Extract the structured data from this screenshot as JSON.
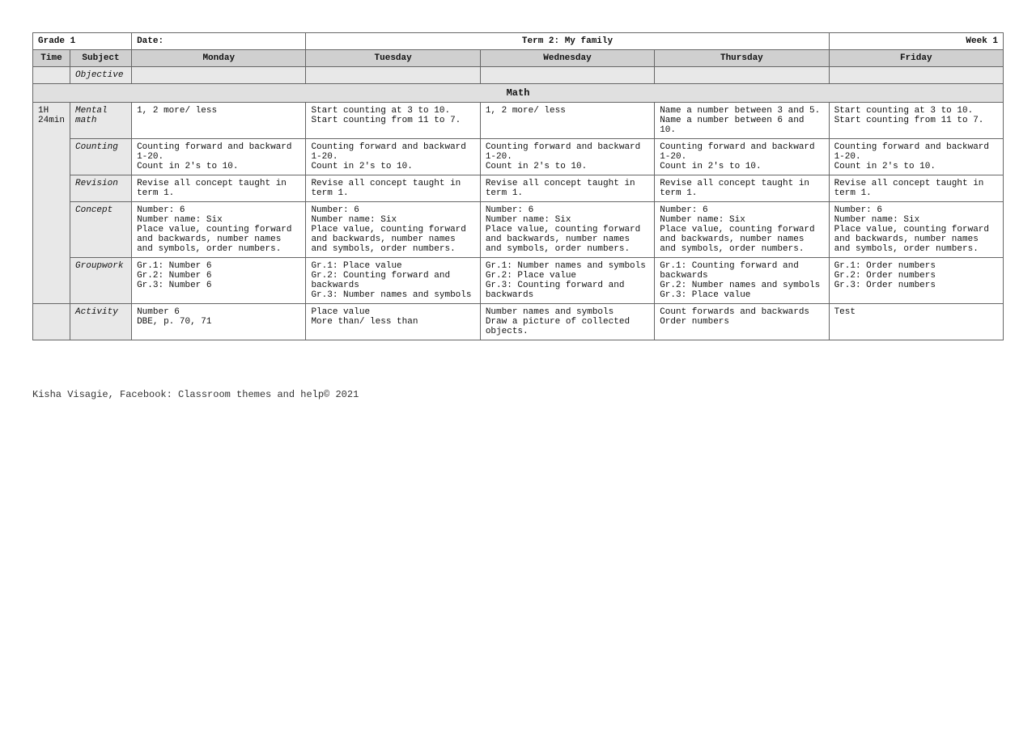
{
  "header": {
    "grade_label": "Grade 1",
    "date_label": "Date:",
    "term_label": "Term 2: My family",
    "week_label": "Week 1"
  },
  "columns": {
    "time": "Time",
    "subject": "Subject",
    "monday": "Monday",
    "tuesday": "Tuesday",
    "wednesday": "Wednesday",
    "thursday": "Thursday",
    "friday": "Friday",
    "objective": "Objective"
  },
  "math_section": "Math",
  "rows": {
    "time": "1H\n24min",
    "subject": "Mental math",
    "monday_mental": "1, 2 more/ less",
    "tuesday_mental": "Start counting at 3 to 10.\nStart counting from 11 to 7.",
    "wednesday_mental": "1, 2 more/ less",
    "thursday_mental": "Name a number between 3 and 5.\nName a number between 6 and 10.",
    "friday_mental": "Start counting at 3 to 10.\nStart counting from 11 to 7.",
    "counting_label": "Counting",
    "monday_counting": "Counting forward and backward 1-20.\nCount in 2's to 10.",
    "tuesday_counting": "Counting forward and backward 1-20.\nCount in 2's to 10.",
    "wednesday_counting": "Counting forward and backward 1-20.\nCount in 2's to 10.",
    "thursday_counting": "Counting forward and backward 1-20.\nCount in 2's to 10.",
    "friday_counting": "Counting forward and backward 1-20.\nCount in 2's to 10.",
    "revision_label": "Revision",
    "monday_revision": "Revise all concept taught in term 1.",
    "tuesday_revision": "Revise all concept taught in term 1.",
    "wednesday_revision": "Revise all concept taught in term 1.",
    "thursday_revision": "Revise all concept taught in term 1.",
    "friday_revision": "Revise all concept taught in term 1.",
    "concept_label": "Concept",
    "monday_concept": "Number: 6\nNumber name: Six\nPlace value, counting forward and backwards, number names and symbols, order numbers.",
    "tuesday_concept": "Number: 6\nNumber name: Six\nPlace value, counting forward and backwards, number names and symbols, order numbers.",
    "wednesday_concept": "Number: 6\nNumber name: Six\nPlace value, counting forward and backwards, number names and symbols, order numbers.",
    "thursday_concept": "Number: 6\nNumber name: Six\nPlace value, counting forward and backwards, number names and symbols, order numbers.",
    "friday_concept": "Number: 6\nNumber name: Six\nPlace value, counting forward and backwards, number names and symbols, order numbers.",
    "groupwork_label": "Groupwork",
    "monday_groupwork": "Gr.1: Number 6\nGr.2: Number 6\nGr.3: Number 6",
    "tuesday_groupwork": "Gr.1: Place value\nGr.2: Counting forward and backwards\nGr.3: Number names and symbols",
    "wednesday_groupwork": "Gr.1: Number names and symbols\nGr.2: Place value\nGr.3: Counting forward and backwards",
    "thursday_groupwork": "Gr.1: Counting forward and backwards\nGr.2: Number names and symbols\nGr.3: Place value",
    "friday_groupwork": "Gr.1: Order numbers\nGr.2: Order numbers\nGr.3: Order numbers",
    "activity_label": "Activity",
    "monday_activity": "Number 6\nDBE, p. 70, 71",
    "tuesday_activity": "Place value\nMore than/ less than",
    "wednesday_activity": "Number names and symbols\nDraw a picture of collected objects.",
    "thursday_activity": "Count forwards and backwards\nOrder numbers",
    "friday_activity": "Test"
  },
  "footer": "Kisha Visagie, Facebook: Classroom themes and help© 2021"
}
